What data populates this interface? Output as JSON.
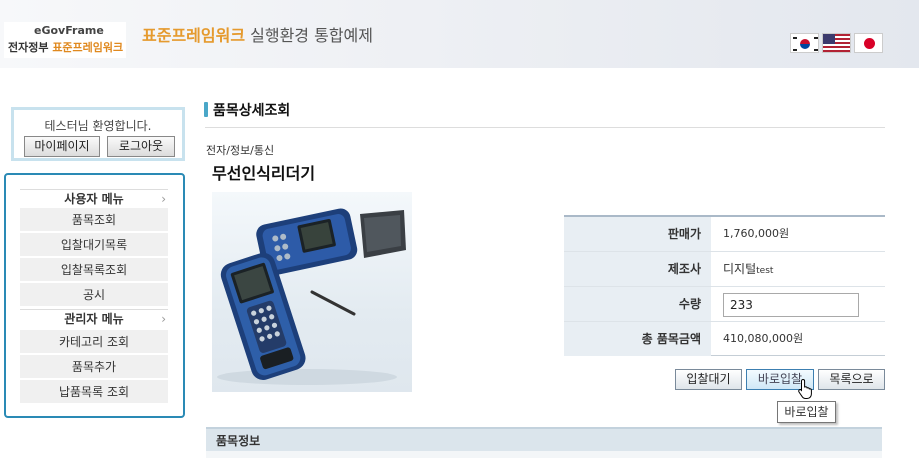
{
  "header": {
    "logo_top": "eGovFrame",
    "logo_bottom_plain": "전자정부 ",
    "logo_bottom_accent": "표준프레임워크",
    "title_highlight": "표준프레임워크",
    "title_rest": " 실행환경 통합예제",
    "flags": [
      "korean-flag-icon",
      "us-flag-icon",
      "japan-flag-icon"
    ]
  },
  "sidebar": {
    "welcome": "테스터님 환영합니다.",
    "mypage_label": "마이페이지",
    "logout_label": "로그아웃",
    "user_menu_title": "사용자 메뉴",
    "user_menu": [
      "품목조회",
      "입찰대기목록",
      "입찰목록조회",
      "공시"
    ],
    "admin_menu_title": "관리자 메뉴",
    "admin_menu": [
      "카테고리 조회",
      "품목추가",
      "납품목록 조회"
    ]
  },
  "main": {
    "page_title": "품목상세조회",
    "breadcrumb": "전자/정보/통신",
    "product_name": "무선인식리더기",
    "details": {
      "price_label": "판매가",
      "price_value": "1,760,000원",
      "maker_label": "제조사",
      "maker_value": "디지털",
      "maker_suffix": "test",
      "qty_label": "수량",
      "qty_value": "233",
      "total_label": "총 품목금액",
      "total_value": "410,080,000원"
    },
    "buttons": {
      "wait_label": "입찰대기",
      "bid_now_label": "바로입찰",
      "list_label": "목록으로"
    },
    "tooltip": "바로입찰",
    "section_title": "품목정보"
  },
  "colors": {
    "accent": "#2a8ab5",
    "title_orange": "#e59a2e",
    "detail_label_bg": "#e8eef3"
  }
}
